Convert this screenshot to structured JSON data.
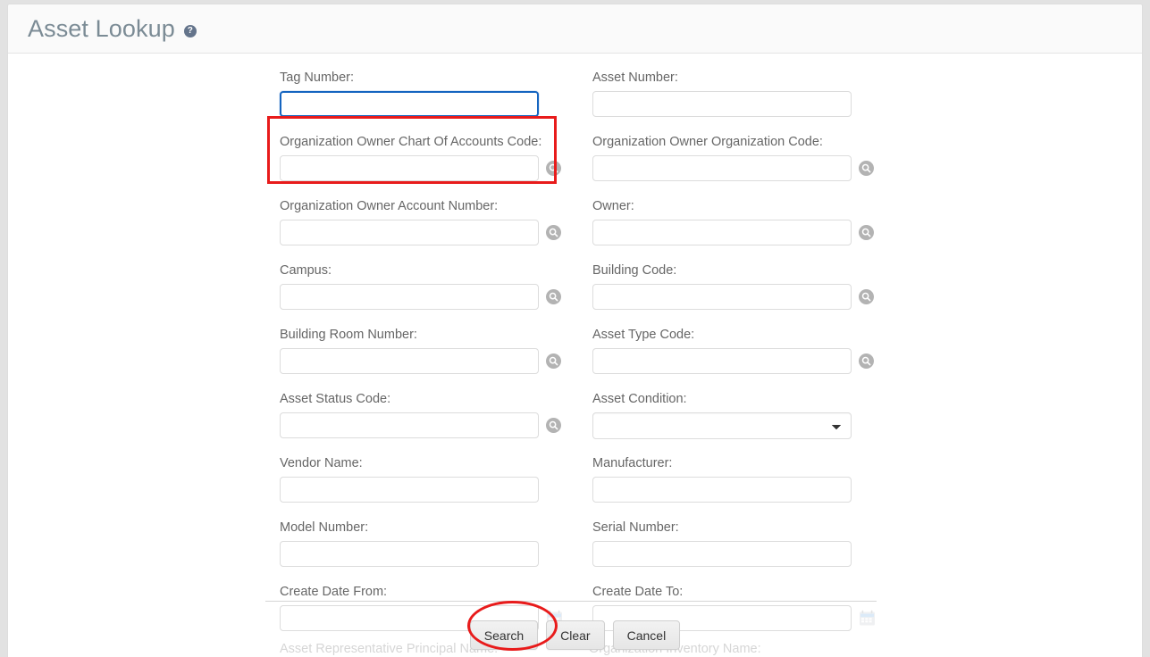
{
  "header": {
    "title": "Asset Lookup",
    "help_icon": "help-circle-icon",
    "help_glyph": "?"
  },
  "form": {
    "rows": [
      {
        "left": {
          "label": "Tag Number:",
          "value": "",
          "placeholder": "",
          "control": "text",
          "focused": true,
          "highlighted": true
        },
        "right": {
          "label": "Asset Number:",
          "value": "",
          "placeholder": "",
          "control": "text"
        }
      },
      {
        "left": {
          "label": "Organization Owner Chart Of Accounts Code:",
          "value": "",
          "placeholder": "",
          "control": "text",
          "lookup": true
        },
        "right": {
          "label": "Organization Owner Organization Code:",
          "value": "",
          "placeholder": "",
          "control": "text",
          "lookup": true
        }
      },
      {
        "left": {
          "label": "Organization Owner Account Number:",
          "value": "",
          "placeholder": "",
          "control": "text",
          "lookup": true
        },
        "right": {
          "label": "Owner:",
          "value": "",
          "placeholder": "",
          "control": "text",
          "lookup": true
        }
      },
      {
        "left": {
          "label": "Campus:",
          "value": "",
          "placeholder": "",
          "control": "text",
          "lookup": true
        },
        "right": {
          "label": "Building Code:",
          "value": "",
          "placeholder": "",
          "control": "text",
          "lookup": true
        }
      },
      {
        "left": {
          "label": "Building Room Number:",
          "value": "",
          "placeholder": "",
          "control": "text",
          "lookup": true
        },
        "right": {
          "label": "Asset Type Code:",
          "value": "",
          "placeholder": "",
          "control": "text",
          "lookup": true
        }
      },
      {
        "left": {
          "label": "Asset Status Code:",
          "value": "",
          "placeholder": "",
          "control": "text",
          "lookup": true
        },
        "right": {
          "label": "Asset Condition:",
          "value": "",
          "placeholder": "",
          "control": "select",
          "options": [
            ""
          ]
        }
      },
      {
        "left": {
          "label": "Vendor Name:",
          "value": "",
          "placeholder": "",
          "control": "text"
        },
        "right": {
          "label": "Manufacturer:",
          "value": "",
          "placeholder": "",
          "control": "text"
        }
      },
      {
        "left": {
          "label": "Model Number:",
          "value": "",
          "placeholder": "",
          "control": "text"
        },
        "right": {
          "label": "Serial Number:",
          "value": "",
          "placeholder": "",
          "control": "text"
        }
      },
      {
        "left": {
          "label": "Create Date From:",
          "value": "",
          "placeholder": "",
          "control": "text",
          "calendar": true
        },
        "right": {
          "label": "Create Date To:",
          "value": "",
          "placeholder": "",
          "control": "text",
          "calendar": true
        }
      }
    ],
    "cutoff_labels": [
      "Asset Representative Principal Name:",
      "Organization Inventory Name:"
    ]
  },
  "buttons": {
    "search": "Search",
    "clear": "Clear",
    "cancel": "Cancel"
  },
  "annotations": {
    "highlight_color": "#e81b1b",
    "focus_color": "#1565c0",
    "tag_number_box": "red-rectangle-highlight",
    "search_ellipse": "red-ellipse-highlight"
  }
}
